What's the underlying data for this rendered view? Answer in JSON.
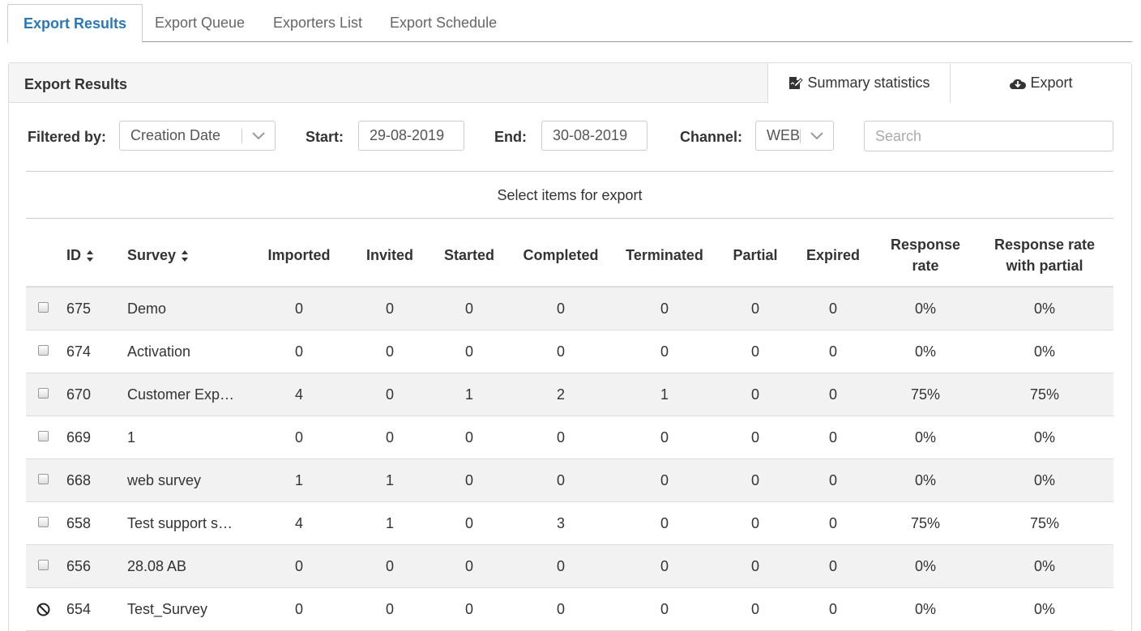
{
  "tabs": [
    {
      "label": "Export Results",
      "active": true
    },
    {
      "label": "Export Queue",
      "active": false
    },
    {
      "label": "Exporters List",
      "active": false
    },
    {
      "label": "Export Schedule",
      "active": false
    }
  ],
  "panel": {
    "title": "Export Results",
    "summary_label": "Summary statistics",
    "export_label": "Export"
  },
  "filters": {
    "filtered_by_label": "Filtered by:",
    "filtered_by_value": "Creation Date",
    "start_label": "Start:",
    "start_value": "29-08-2019",
    "end_label": "End:",
    "end_value": "30-08-2019",
    "channel_label": "Channel:",
    "channel_value": "WEB",
    "search_placeholder": "Search"
  },
  "select_items_text": "Select items for export",
  "table": {
    "headers": {
      "id": "ID",
      "survey": "Survey",
      "imported": "Imported",
      "invited": "Invited",
      "started": "Started",
      "completed": "Completed",
      "terminated": "Terminated",
      "partial": "Partial",
      "expired": "Expired",
      "response_rate_1": "Response",
      "response_rate_2": "rate",
      "response_rate_partial_1": "Response rate",
      "response_rate_partial_2": "with partial"
    },
    "rows": [
      {
        "id": "675",
        "survey": "Demo",
        "imported": "0",
        "invited": "0",
        "started": "0",
        "completed": "0",
        "terminated": "0",
        "partial": "0",
        "expired": "0",
        "rr": "0%",
        "rrp": "0%",
        "selectable": true
      },
      {
        "id": "674",
        "survey": "Activation",
        "imported": "0",
        "invited": "0",
        "started": "0",
        "completed": "0",
        "terminated": "0",
        "partial": "0",
        "expired": "0",
        "rr": "0%",
        "rrp": "0%",
        "selectable": true
      },
      {
        "id": "670",
        "survey": "Customer Exp…",
        "imported": "4",
        "invited": "0",
        "started": "1",
        "completed": "2",
        "terminated": "1",
        "partial": "0",
        "expired": "0",
        "rr": "75%",
        "rrp": "75%",
        "selectable": true
      },
      {
        "id": "669",
        "survey": "1",
        "imported": "0",
        "invited": "0",
        "started": "0",
        "completed": "0",
        "terminated": "0",
        "partial": "0",
        "expired": "0",
        "rr": "0%",
        "rrp": "0%",
        "selectable": true
      },
      {
        "id": "668",
        "survey": "web survey",
        "imported": "1",
        "invited": "1",
        "started": "0",
        "completed": "0",
        "terminated": "0",
        "partial": "0",
        "expired": "0",
        "rr": "0%",
        "rrp": "0%",
        "selectable": true
      },
      {
        "id": "658",
        "survey": "Test support s…",
        "imported": "4",
        "invited": "1",
        "started": "0",
        "completed": "3",
        "terminated": "0",
        "partial": "0",
        "expired": "0",
        "rr": "75%",
        "rrp": "75%",
        "selectable": true
      },
      {
        "id": "656",
        "survey": "28.08 AB",
        "imported": "0",
        "invited": "0",
        "started": "0",
        "completed": "0",
        "terminated": "0",
        "partial": "0",
        "expired": "0",
        "rr": "0%",
        "rrp": "0%",
        "selectable": true
      },
      {
        "id": "654",
        "survey": "Test_Survey",
        "imported": "0",
        "invited": "0",
        "started": "0",
        "completed": "0",
        "terminated": "0",
        "partial": "0",
        "expired": "0",
        "rr": "0%",
        "rrp": "0%",
        "selectable": false
      }
    ]
  },
  "colors": {
    "accent": "#2a78b8",
    "stripe": "#f2f2f2"
  }
}
